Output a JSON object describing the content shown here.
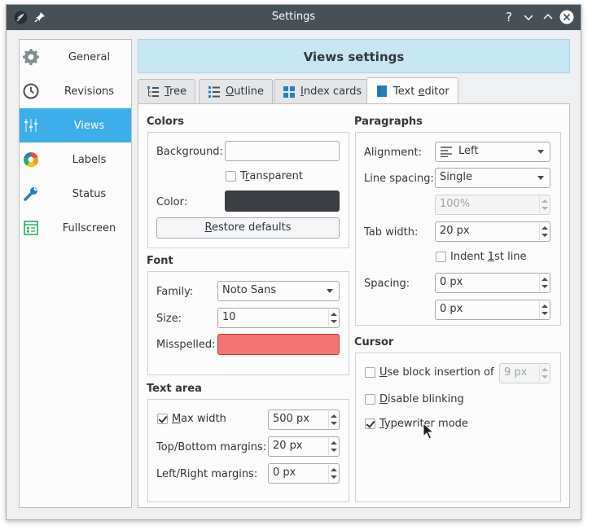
{
  "window": {
    "title": "Settings"
  },
  "sidebar": {
    "items": [
      {
        "label": "General",
        "icon": "gear-icon",
        "active": false
      },
      {
        "label": "Revisions",
        "icon": "clock-icon",
        "active": false
      },
      {
        "label": "Views",
        "icon": "equalizer-icon",
        "active": true
      },
      {
        "label": "Labels",
        "icon": "color-wheel-icon",
        "active": false
      },
      {
        "label": "Status",
        "icon": "wrench-icon",
        "active": false
      },
      {
        "label": "Fullscreen",
        "icon": "fullscreen-icon",
        "active": false
      }
    ]
  },
  "header": {
    "title": "Views settings"
  },
  "tabs": [
    {
      "label_pre": "",
      "label_u": "T",
      "label_post": "ree",
      "icon": "tree-icon"
    },
    {
      "label_pre": "",
      "label_u": "O",
      "label_post": "utline",
      "icon": "outline-icon"
    },
    {
      "label_pre": "",
      "label_u": "I",
      "label_post": "ndex cards",
      "icon": "index-cards-icon"
    },
    {
      "label_pre": "Text ",
      "label_u": "e",
      "label_post": "ditor",
      "icon": "text-editor-icon",
      "active": true
    }
  ],
  "colors": {
    "title": "Colors",
    "background_label": "Background:",
    "transparent_pre": "T",
    "transparent_u": "r",
    "transparent_post": "ansparent",
    "transparent_checked": false,
    "color_label": "Color:",
    "color_value": "#3b3e42",
    "restore_pre": "",
    "restore_u": "R",
    "restore_post": "estore defaults"
  },
  "font": {
    "title": "Font",
    "family_label": "Family:",
    "family_value": "Noto Sans",
    "size_label": "Size:",
    "size_value": "10",
    "misspelled_label": "Misspelled:",
    "misspelled_color": "#f47575"
  },
  "text_area": {
    "title": "Text area",
    "max_width_u": "M",
    "max_width_post": "ax width",
    "max_width_checked": true,
    "max_width_value": "500 px",
    "topbottom_label": "Top/Bottom margins:",
    "topbottom_value": "20 px",
    "leftright_label": "Left/Right margins:",
    "leftright_value": "0 px"
  },
  "paragraphs": {
    "title": "Paragraphs",
    "alignment_label": "Alignment:",
    "alignment_value": "Left",
    "line_spacing_label": "Line spacing:",
    "line_spacing_value": "Single",
    "line_spacing_percent": "100%",
    "tab_width_label": "Tab width:",
    "tab_width_value": "20 px",
    "indent_pre": "Indent ",
    "indent_u": "1",
    "indent_post": "st line",
    "indent_checked": false,
    "spacing_label": "Spacing:",
    "spacing_above": "0 px",
    "spacing_below": "0 px"
  },
  "cursor": {
    "title": "Cursor",
    "block_u": "U",
    "block_post": "se block insertion of",
    "block_checked": false,
    "block_value": "9 px",
    "blink_u": "D",
    "blink_post": "isable blinking",
    "blink_checked": false,
    "typewriter_u": "T",
    "typewriter_post": "ypewriter mode",
    "typewriter_checked": true
  }
}
